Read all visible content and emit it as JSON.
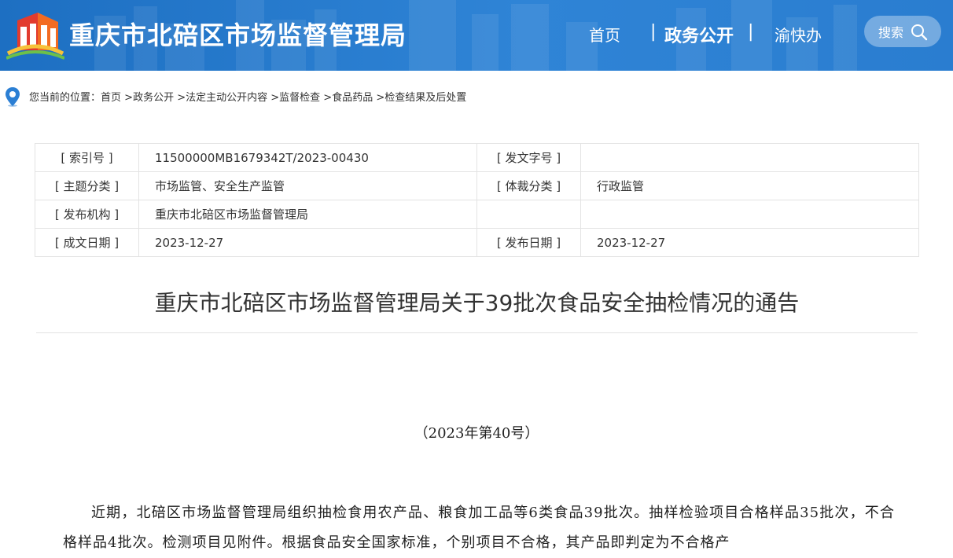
{
  "header": {
    "site_title": "重庆市北碚区市场监督管理局",
    "nav": {
      "home": "首页",
      "sep": "|",
      "gov_affairs": "政务公开",
      "yukuaiban": "渝快办"
    },
    "search_label": "搜索"
  },
  "breadcrumb": {
    "prefix": "您当前的位置：",
    "items": [
      "首页",
      "政务公开",
      "法定主动公开内容",
      "监督检查",
      "食品药品",
      "检查结果及后处置"
    ],
    "separator": " >"
  },
  "meta": {
    "index_key": "[ 索引号 ]",
    "index_val": "11500000MB1679342T/2023-00430",
    "docnum_key": "[ 发文字号 ]",
    "docnum_val": "",
    "topic_key": "[ 主题分类 ]",
    "topic_val": "市场监管、安全生产监管",
    "genre_key": "[ 体裁分类 ]",
    "genre_val": "行政监管",
    "issuer_key": "[ 发布机构 ]",
    "issuer_val": "重庆市北碚区市场监督管理局",
    "date_key": "[ 成文日期 ]",
    "date_val": "2023-12-27",
    "pubdate_key": "[ 发布日期 ]",
    "pubdate_val": "2023-12-27"
  },
  "doc": {
    "title": "重庆市北碚区市场监督管理局关于39批次食品安全抽检情况的通告",
    "number": "（2023年第40号）",
    "body": "近期，北碚区市场监督管理局组织抽检食用农产品、粮食加工品等6类食品39批次。抽样检验项目合格样品35批次，不合格样品4批次。检测项目见附件。根据食品安全国家标准，个别项目不合格，其产品即判定为不合格产"
  },
  "colors": {
    "header_blue": "#2a7dd0",
    "text": "#333333",
    "border": "#e3e3e3"
  }
}
